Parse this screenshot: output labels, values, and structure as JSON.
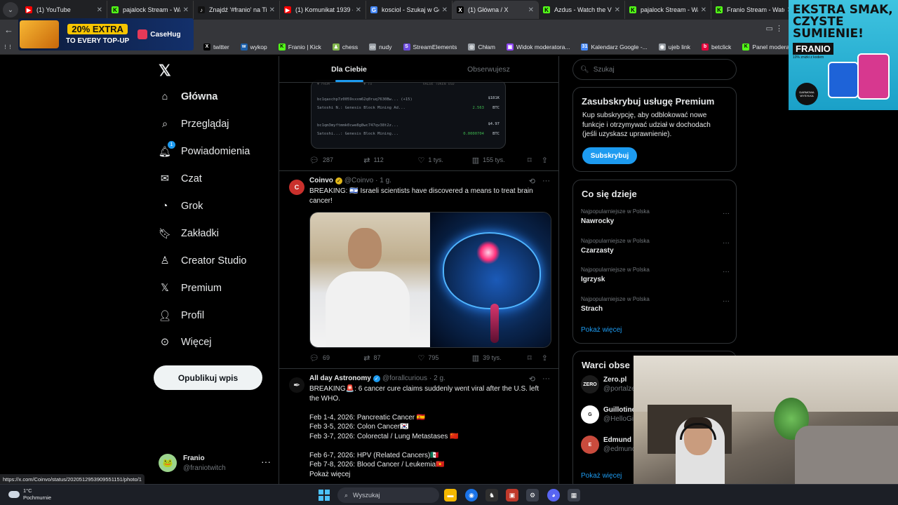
{
  "browser": {
    "tabs": [
      {
        "title": "(1) YouTube",
        "color": "#ff0000",
        "glyph": "▶"
      },
      {
        "title": "pajalock Stream - Wa",
        "color": "#53fc18",
        "glyph": "K"
      },
      {
        "title": "Znajdź '#franio' na Ti",
        "color": "#111111",
        "glyph": "♪"
      },
      {
        "title": "(1) Komunikat 1939 -",
        "color": "#ff0000",
        "glyph": "▶"
      },
      {
        "title": "kosciol - Szukaj w Go",
        "color": "#4285f4",
        "glyph": "G"
      },
      {
        "title": "(1) Główna / X",
        "color": "#000000",
        "glyph": "X"
      },
      {
        "title": "Azdus - Watch the V",
        "color": "#53fc18",
        "glyph": "K"
      },
      {
        "title": "pajalock Stream - Wa",
        "color": "#53fc18",
        "glyph": "K"
      },
      {
        "title": "Franio Stream - Watc",
        "color": "#53fc18",
        "glyph": "K"
      }
    ],
    "bookmarks": [
      {
        "label": "twitter",
        "glyph": "X",
        "color": "#000000"
      },
      {
        "label": "wykop",
        "glyph": "w",
        "color": "#1b5ea8"
      },
      {
        "label": "Franio | Kick",
        "glyph": "K",
        "color": "#53fc18"
      },
      {
        "label": "chess",
        "glyph": "♟",
        "color": "#81b64c"
      },
      {
        "label": "nudy",
        "glyph": "▭",
        "color": "#9aa0a6"
      },
      {
        "label": "StreamElements",
        "glyph": "S",
        "color": "#6c4bde"
      },
      {
        "label": "Chłam",
        "glyph": "◎",
        "color": "#9aa0a6"
      },
      {
        "label": "Widok moderatora...",
        "glyph": "▣",
        "color": "#9146ff"
      },
      {
        "label": "Kalendarz Google -...",
        "glyph": "31",
        "color": "#4285f4"
      },
      {
        "label": "ujeb link",
        "glyph": "◉",
        "color": "#9aa0a6"
      },
      {
        "label": "betclick",
        "glyph": "b",
        "color": "#e4003a"
      },
      {
        "label": "Panel moderatora |...",
        "glyph": "K",
        "color": "#53fc18"
      }
    ],
    "status_url": "https://x.com/Coinvo/status/2020512953909551151/photo/1"
  },
  "ads": {
    "casehug": {
      "line1": "20% EXTRA",
      "line2": "TO EVERY TOP-UP",
      "brand": "CaseHug"
    },
    "franio": {
      "headline": "EKSTRA SMAK, CZYSTE SUMIENIE!",
      "brand": "FRANIO",
      "sub": "10% zniżki z kodem",
      "badge": "DARMOWA WYSYŁKA"
    }
  },
  "sidebar": {
    "items": [
      {
        "label": "Główna",
        "icon": "home-icon"
      },
      {
        "label": "Przeglądaj",
        "icon": "search-icon"
      },
      {
        "label": "Powiadomienia",
        "icon": "bell-icon",
        "badge": "1"
      },
      {
        "label": "Czat",
        "icon": "mail-icon"
      },
      {
        "label": "Grok",
        "icon": "grok-icon"
      },
      {
        "label": "Zakładki",
        "icon": "bookmark-icon"
      },
      {
        "label": "Creator Studio",
        "icon": "creator-icon"
      },
      {
        "label": "Premium",
        "icon": "x-icon"
      },
      {
        "label": "Profil",
        "icon": "person-icon"
      },
      {
        "label": "Więcej",
        "icon": "more-circle-icon"
      }
    ],
    "post_label": "Opublikuj wpis",
    "profile": {
      "name": "Franio",
      "handle": "@franiotwitch"
    }
  },
  "timeline": {
    "tabs": [
      "Dla Ciebie",
      "Obserwujesz"
    ],
    "first_post": {
      "tx_rows": [
        {
          "addr": "bc1qaxchp7z0059sxxm62q0ruq7630Bw...  (+15)",
          "sub": "Satoshi N.: Genesis Block Mining Ad...",
          "amount": "2.563",
          "usd": "$181K"
        },
        {
          "addr": "bc1qm3myftmmk0cwe8g8wc747qv38t2z...",
          "sub": "Satoshi...: Genesis Block Mining...",
          "amount": "0.0000704",
          "usd": "$4.97"
        }
      ],
      "tx_unit": "BTC",
      "stats": {
        "replies": "287",
        "reposts": "112",
        "likes": "1 tys.",
        "views": "155 tys."
      }
    },
    "posts": [
      {
        "name": "Coinvo",
        "handle": "@Coinvo",
        "time": "· 1 g.",
        "lines": [
          "BREAKING: 🇮🇱 Israeli scientists have discovered a means to treat brain",
          "cancer!"
        ],
        "stats": {
          "replies": "69",
          "reposts": "87",
          "likes": "795",
          "views": "39 tys."
        }
      },
      {
        "name": "All day Astronomy",
        "handle": "@forallcurious",
        "time": "· 2 g.",
        "lines": [
          "BREAKING🚨: 6 cancer cure claims suddenly went viral after the U.S. left",
          "the WHO.",
          "",
          "Feb 1-4, 2026: Pancreatic Cancer 🇪🇸",
          "Feb 3-5, 2026: Colon Cancer🇰🇷",
          "Feb 3-7, 2026: Colorectal / Lung Metastases 🇨🇳",
          "",
          "Feb 6-7, 2026: HPV (Related Cancers)🇲🇽",
          "Feb 7-8, 2026: Blood Cancer / Leukemia🇻🇳"
        ],
        "show_more": "Pokaż więcej"
      }
    ]
  },
  "rightcol": {
    "search_placeholder": "Szukaj",
    "premium": {
      "title": "Zasubskrybuj usługę Premium",
      "text_lines": [
        "Kup subskrypcję, aby odblokować nowe",
        "funkcje i otrzymywać udział w dochodach",
        "(jeśli uzyskasz uprawnienie)."
      ],
      "button": "Subskrybuj"
    },
    "trends": {
      "title": "Co się dzieje",
      "items": [
        {
          "context": "Najpopularniejsze w Polska",
          "topic": "Nawrocky"
        },
        {
          "context": "Najpopularniejsze w Polska",
          "topic": "Czarzasty"
        },
        {
          "context": "Najpopularniejsze w Polska",
          "topic": "Igrzysk"
        },
        {
          "context": "Najpopularniejsze w Polska",
          "topic": "Strach"
        }
      ],
      "show_more": "Pokaż więcej"
    },
    "who_to_follow": {
      "title": "Warci obse",
      "items": [
        {
          "name": "Zero.pl",
          "handle": "@portalze",
          "avatar_text": "ZERO"
        },
        {
          "name": "Guillotine",
          "handle": "@HelloGi",
          "avatar_text": "G"
        },
        {
          "name": "Edmund",
          "handle": "@edmunc",
          "avatar_text": "E"
        }
      ],
      "show_more": "Pokaż więcej"
    }
  },
  "taskbar": {
    "weather_temp": "1°C",
    "weather_desc": "Pochmurnie",
    "search_label": "Wyszukaj"
  }
}
